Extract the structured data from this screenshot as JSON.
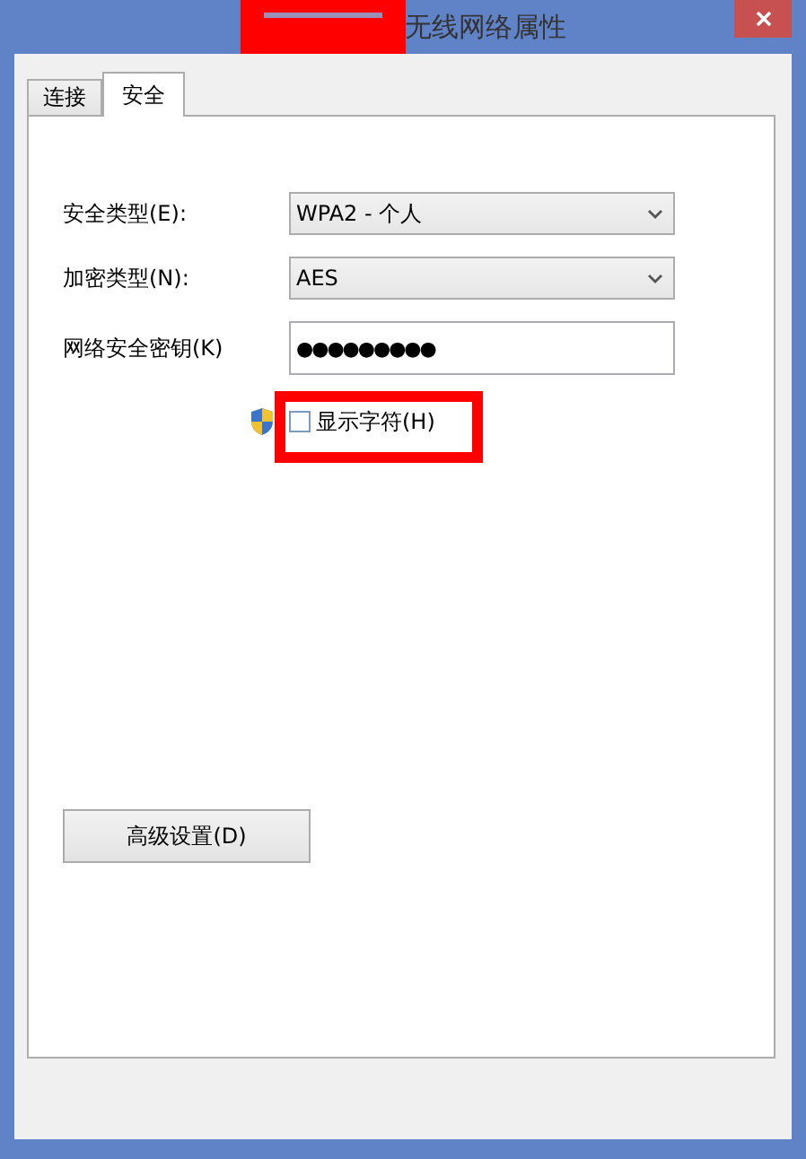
{
  "window": {
    "title": "无线网络属性",
    "title_redacted": true
  },
  "tabs": [
    {
      "label": "连接",
      "selected": false
    },
    {
      "label": "安全",
      "selected": true
    }
  ],
  "fields": [
    {
      "kind": "dropdown",
      "label": "安全类型(E):",
      "value": "WPA2 - 个人"
    },
    {
      "kind": "dropdown",
      "label": "加密类型(N):",
      "value": "AES"
    },
    {
      "kind": "password",
      "label": "网络安全密钥(K)",
      "value": "●●●●●●●●●"
    }
  ],
  "show_characters": {
    "label": "显示字符(H)",
    "checked": false,
    "highlighted": true
  },
  "advanced_button": {
    "label": "高级设置(D)"
  }
}
